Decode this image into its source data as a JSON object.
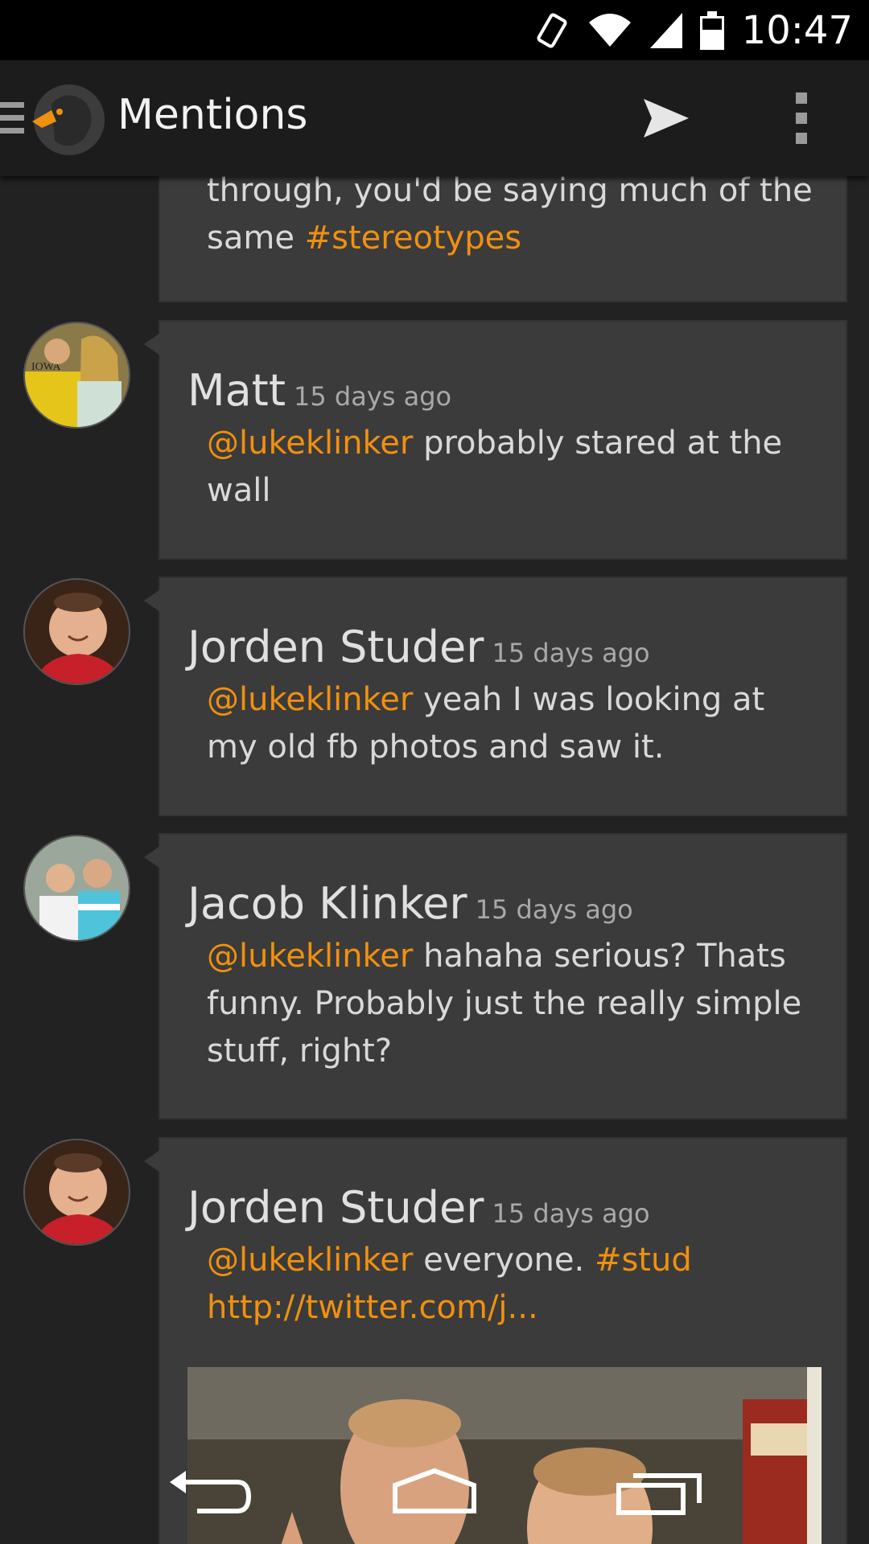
{
  "status_bar": {
    "time": "10:47",
    "icons": [
      "vibrate-icon",
      "wifi-icon",
      "signal-icon",
      "battery-icon"
    ]
  },
  "action_bar": {
    "title": "Mentions",
    "icons": [
      "drawer-icon",
      "app-logo",
      "send-icon",
      "overflow-menu-icon"
    ]
  },
  "feed": {
    "partial_tweet": {
      "line1": "through, you'd be saying much of the",
      "line2_prefix": "same ",
      "line2_hashtag": "#stereotypes"
    },
    "tweets": [
      {
        "author": "Matt",
        "time": "15 days ago",
        "mention": "@lukeklinker",
        "text": " probably stared at the wall"
      },
      {
        "author": "Jorden Studer",
        "time": "15 days ago",
        "mention": "@lukeklinker",
        "text": " yeah I was looking at my old fb photos and saw it."
      },
      {
        "author": "Jacob Klinker",
        "time": "15 days ago",
        "mention": "@lukeklinker",
        "text": " hahaha serious? Thats funny. Probably just the really simple stuff, right?"
      },
      {
        "author": "Jorden Studer",
        "time": "15 days ago",
        "mention": "@lukeklinker",
        "text": " everyone. ",
        "hashtag": "#stud",
        "link": " http://twitter.com/j..."
      }
    ]
  },
  "nav_bar": {
    "icons": [
      "back-icon",
      "home-icon",
      "recents-icon"
    ]
  },
  "colors": {
    "accent": "#f0900f",
    "card": "#3b3b3b",
    "background": "#222222"
  }
}
